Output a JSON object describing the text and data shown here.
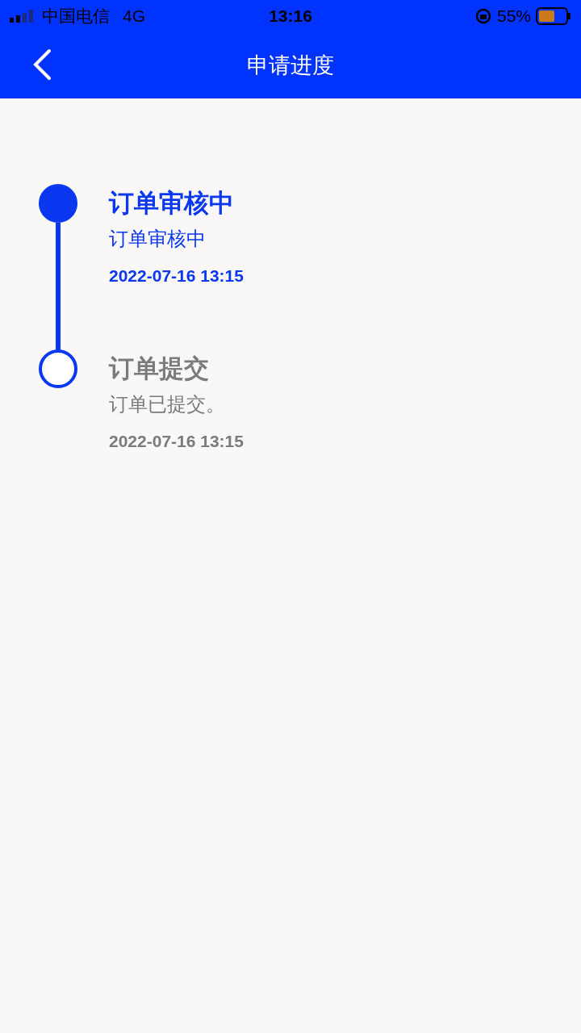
{
  "status_bar": {
    "carrier": "中国电信",
    "network": "4G",
    "time": "13:16",
    "battery": "55%"
  },
  "nav": {
    "title": "申请进度"
  },
  "timeline": [
    {
      "title": "订单审核中",
      "detail": "订单审核中",
      "time": "2022-07-16 13:15",
      "active": true
    },
    {
      "title": "订单提交",
      "detail": "订单已提交。",
      "time": "2022-07-16 13:15",
      "active": false
    }
  ]
}
